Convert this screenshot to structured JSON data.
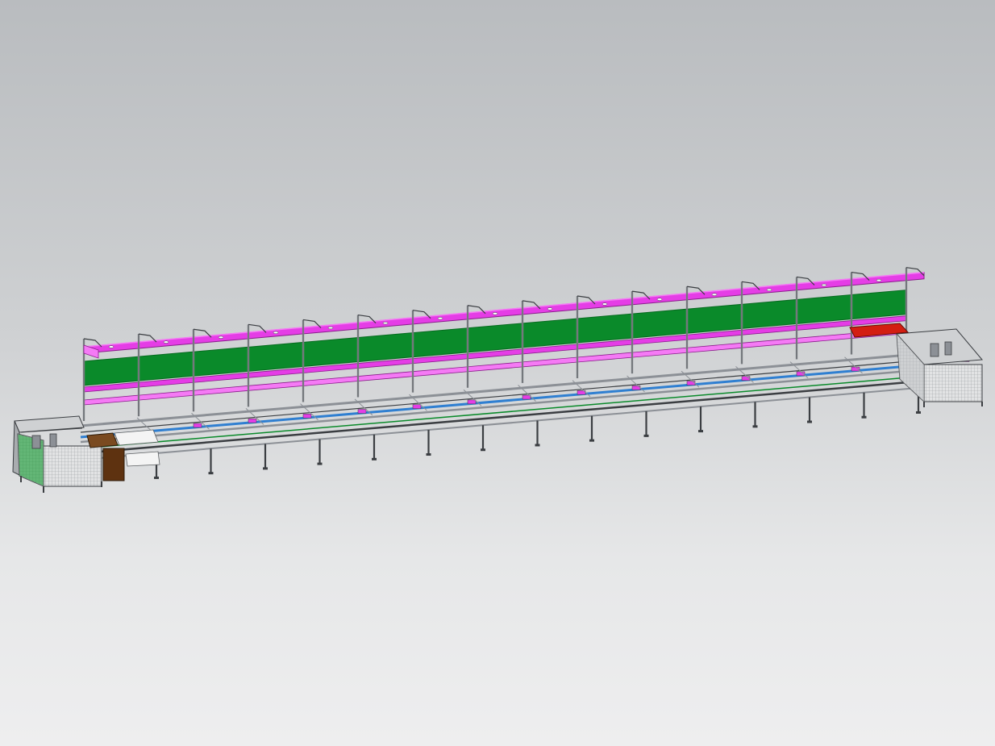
{
  "scene": {
    "description_visible_text": "",
    "colors": {
      "background_top": "#b9bcbf",
      "background_bottom": "#eeeeef",
      "frame": "#8c9096",
      "frame_dark": "#3b3e42",
      "shelf": "#e53de6",
      "shelf_light": "#f57af5",
      "panel_green": "#0a8a2a",
      "panel_green_dark": "#066b1f",
      "conveyor_blue": "#2f7fd1",
      "accent_red": "#d31e12",
      "accent_brown": "#6b3b14",
      "cabinet_grid": "#d9dadb"
    },
    "workstations": 15,
    "icons": [
      "workstation-frame",
      "shelf",
      "green-panel",
      "conveyor",
      "end-cabinet",
      "support-leg"
    ]
  }
}
